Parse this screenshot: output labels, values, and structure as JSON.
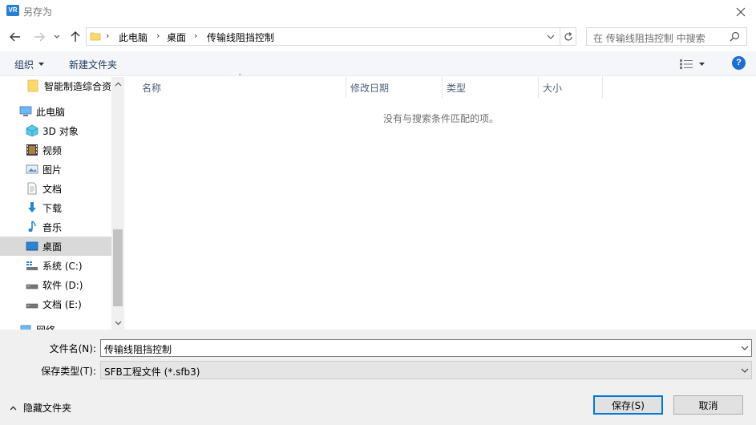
{
  "window": {
    "title": "另存为",
    "app_icon_text": "VR"
  },
  "address": {
    "breadcrumbs": [
      "此电脑",
      "桌面",
      "传输线阻挡控制"
    ],
    "search_placeholder": "在 传输线阻挡控制 中搜索"
  },
  "toolbar": {
    "organize_label": "组织",
    "new_folder_label": "新建文件夹",
    "help_label": "?"
  },
  "nav": {
    "items": [
      {
        "label": "智能制造综合资",
        "icon": "folder-icon",
        "indent": 1
      },
      {
        "label": "此电脑",
        "icon": "computer-icon",
        "indent": 0
      },
      {
        "label": "3D 对象",
        "icon": "3d-objects-icon",
        "indent": 1
      },
      {
        "label": "视频",
        "icon": "video-icon",
        "indent": 1
      },
      {
        "label": "图片",
        "icon": "pictures-icon",
        "indent": 1
      },
      {
        "label": "文档",
        "icon": "documents-icon",
        "indent": 1
      },
      {
        "label": "下载",
        "icon": "download-icon",
        "indent": 1
      },
      {
        "label": "音乐",
        "icon": "music-icon",
        "indent": 1
      },
      {
        "label": "桌面",
        "icon": "desktop-icon",
        "indent": 1,
        "selected": true
      },
      {
        "label": "系统 (C:)",
        "icon": "system-drive-icon",
        "indent": 1
      },
      {
        "label": "软件 (D:)",
        "icon": "drive-icon",
        "indent": 1
      },
      {
        "label": "文档 (E:)",
        "icon": "drive-icon",
        "indent": 1
      },
      {
        "label": "网络",
        "icon": "network-icon",
        "indent": 0
      }
    ]
  },
  "content": {
    "columns": [
      "名称",
      "修改日期",
      "类型",
      "大小"
    ],
    "empty_message": "没有与搜索条件匹配的项。"
  },
  "form": {
    "filename_label": "文件名(N):",
    "filename_value": "传输线阻挡控制",
    "filetype_label": "保存类型(T):",
    "filetype_value": "SFB工程文件 (*.sfb3)"
  },
  "footer": {
    "hide_folders_label": "隐藏文件夹",
    "save_label": "保存(S)",
    "cancel_label": "取消"
  },
  "colors": {
    "accent": "#0078d7",
    "toolbar_bg": "#f4f6f9",
    "selected_bg": "#d9d9d9",
    "help_blue": "#1c6fd1"
  }
}
